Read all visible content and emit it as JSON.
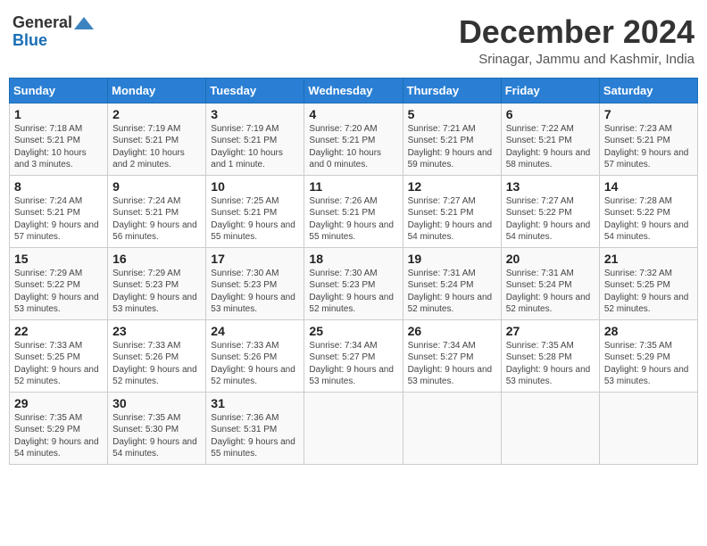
{
  "header": {
    "logo_general": "General",
    "logo_blue": "Blue",
    "month_title": "December 2024",
    "location": "Srinagar, Jammu and Kashmir, India"
  },
  "days_of_week": [
    "Sunday",
    "Monday",
    "Tuesday",
    "Wednesday",
    "Thursday",
    "Friday",
    "Saturday"
  ],
  "weeks": [
    [
      {
        "day": "1",
        "sunrise": "7:18 AM",
        "sunset": "5:21 PM",
        "daylight": "10 hours and 3 minutes."
      },
      {
        "day": "2",
        "sunrise": "7:19 AM",
        "sunset": "5:21 PM",
        "daylight": "10 hours and 2 minutes."
      },
      {
        "day": "3",
        "sunrise": "7:19 AM",
        "sunset": "5:21 PM",
        "daylight": "10 hours and 1 minute."
      },
      {
        "day": "4",
        "sunrise": "7:20 AM",
        "sunset": "5:21 PM",
        "daylight": "10 hours and 0 minutes."
      },
      {
        "day": "5",
        "sunrise": "7:21 AM",
        "sunset": "5:21 PM",
        "daylight": "9 hours and 59 minutes."
      },
      {
        "day": "6",
        "sunrise": "7:22 AM",
        "sunset": "5:21 PM",
        "daylight": "9 hours and 58 minutes."
      },
      {
        "day": "7",
        "sunrise": "7:23 AM",
        "sunset": "5:21 PM",
        "daylight": "9 hours and 57 minutes."
      }
    ],
    [
      {
        "day": "8",
        "sunrise": "7:24 AM",
        "sunset": "5:21 PM",
        "daylight": "9 hours and 57 minutes."
      },
      {
        "day": "9",
        "sunrise": "7:24 AM",
        "sunset": "5:21 PM",
        "daylight": "9 hours and 56 minutes."
      },
      {
        "day": "10",
        "sunrise": "7:25 AM",
        "sunset": "5:21 PM",
        "daylight": "9 hours and 55 minutes."
      },
      {
        "day": "11",
        "sunrise": "7:26 AM",
        "sunset": "5:21 PM",
        "daylight": "9 hours and 55 minutes."
      },
      {
        "day": "12",
        "sunrise": "7:27 AM",
        "sunset": "5:21 PM",
        "daylight": "9 hours and 54 minutes."
      },
      {
        "day": "13",
        "sunrise": "7:27 AM",
        "sunset": "5:22 PM",
        "daylight": "9 hours and 54 minutes."
      },
      {
        "day": "14",
        "sunrise": "7:28 AM",
        "sunset": "5:22 PM",
        "daylight": "9 hours and 54 minutes."
      }
    ],
    [
      {
        "day": "15",
        "sunrise": "7:29 AM",
        "sunset": "5:22 PM",
        "daylight": "9 hours and 53 minutes."
      },
      {
        "day": "16",
        "sunrise": "7:29 AM",
        "sunset": "5:23 PM",
        "daylight": "9 hours and 53 minutes."
      },
      {
        "day": "17",
        "sunrise": "7:30 AM",
        "sunset": "5:23 PM",
        "daylight": "9 hours and 53 minutes."
      },
      {
        "day": "18",
        "sunrise": "7:30 AM",
        "sunset": "5:23 PM",
        "daylight": "9 hours and 52 minutes."
      },
      {
        "day": "19",
        "sunrise": "7:31 AM",
        "sunset": "5:24 PM",
        "daylight": "9 hours and 52 minutes."
      },
      {
        "day": "20",
        "sunrise": "7:31 AM",
        "sunset": "5:24 PM",
        "daylight": "9 hours and 52 minutes."
      },
      {
        "day": "21",
        "sunrise": "7:32 AM",
        "sunset": "5:25 PM",
        "daylight": "9 hours and 52 minutes."
      }
    ],
    [
      {
        "day": "22",
        "sunrise": "7:33 AM",
        "sunset": "5:25 PM",
        "daylight": "9 hours and 52 minutes."
      },
      {
        "day": "23",
        "sunrise": "7:33 AM",
        "sunset": "5:26 PM",
        "daylight": "9 hours and 52 minutes."
      },
      {
        "day": "24",
        "sunrise": "7:33 AM",
        "sunset": "5:26 PM",
        "daylight": "9 hours and 52 minutes."
      },
      {
        "day": "25",
        "sunrise": "7:34 AM",
        "sunset": "5:27 PM",
        "daylight": "9 hours and 53 minutes."
      },
      {
        "day": "26",
        "sunrise": "7:34 AM",
        "sunset": "5:27 PM",
        "daylight": "9 hours and 53 minutes."
      },
      {
        "day": "27",
        "sunrise": "7:35 AM",
        "sunset": "5:28 PM",
        "daylight": "9 hours and 53 minutes."
      },
      {
        "day": "28",
        "sunrise": "7:35 AM",
        "sunset": "5:29 PM",
        "daylight": "9 hours and 53 minutes."
      }
    ],
    [
      {
        "day": "29",
        "sunrise": "7:35 AM",
        "sunset": "5:29 PM",
        "daylight": "9 hours and 54 minutes."
      },
      {
        "day": "30",
        "sunrise": "7:35 AM",
        "sunset": "5:30 PM",
        "daylight": "9 hours and 54 minutes."
      },
      {
        "day": "31",
        "sunrise": "7:36 AM",
        "sunset": "5:31 PM",
        "daylight": "9 hours and 55 minutes."
      },
      null,
      null,
      null,
      null
    ]
  ]
}
